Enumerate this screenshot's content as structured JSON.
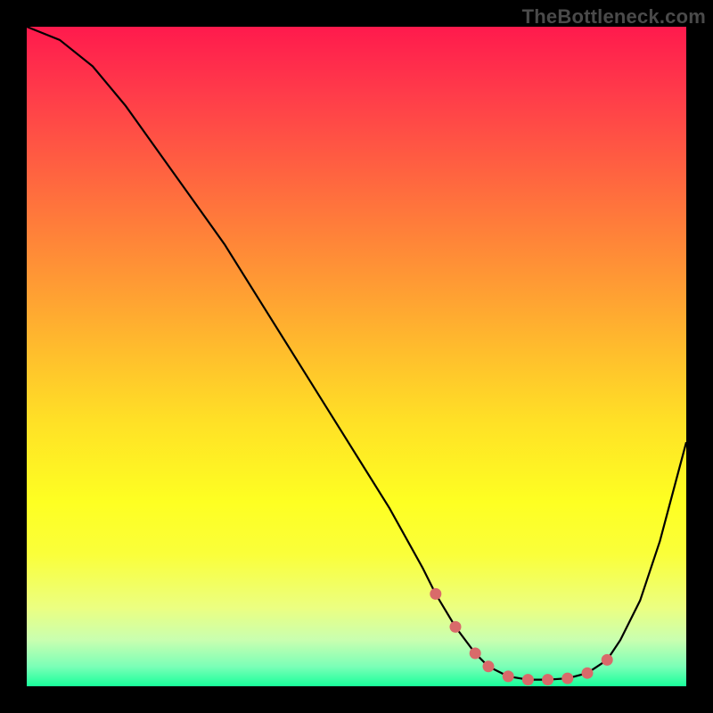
{
  "watermark": "TheBottleneck.com",
  "colors": {
    "curve": "#000000",
    "marker_fill": "#d96a6a",
    "marker_stroke": "#d96a6a"
  },
  "chart_data": {
    "type": "line",
    "title": "",
    "xlabel": "",
    "ylabel": "",
    "xlim": [
      0,
      100
    ],
    "ylim": [
      0,
      100
    ],
    "series": [
      {
        "name": "bottleneck-curve",
        "x": [
          0,
          5,
          10,
          15,
          20,
          25,
          30,
          35,
          40,
          45,
          50,
          55,
          60,
          62,
          65,
          68,
          70,
          73,
          76,
          79,
          82,
          85,
          88,
          90,
          93,
          96,
          100
        ],
        "values": [
          100,
          98,
          94,
          88,
          81,
          74,
          67,
          59,
          51,
          43,
          35,
          27,
          18,
          14,
          9,
          5,
          3,
          1.5,
          1,
          1,
          1.2,
          2,
          4,
          7,
          13,
          22,
          37
        ]
      }
    ],
    "markers": {
      "name": "highlighted-points",
      "x": [
        62,
        65,
        68,
        70,
        73,
        76,
        79,
        82,
        85,
        88
      ],
      "values": [
        14,
        9,
        5,
        3,
        1.5,
        1,
        1,
        1.2,
        2,
        4
      ]
    },
    "gradient_meaning": "background encodes bottleneck severity: red=high, green=low",
    "annotations": []
  }
}
